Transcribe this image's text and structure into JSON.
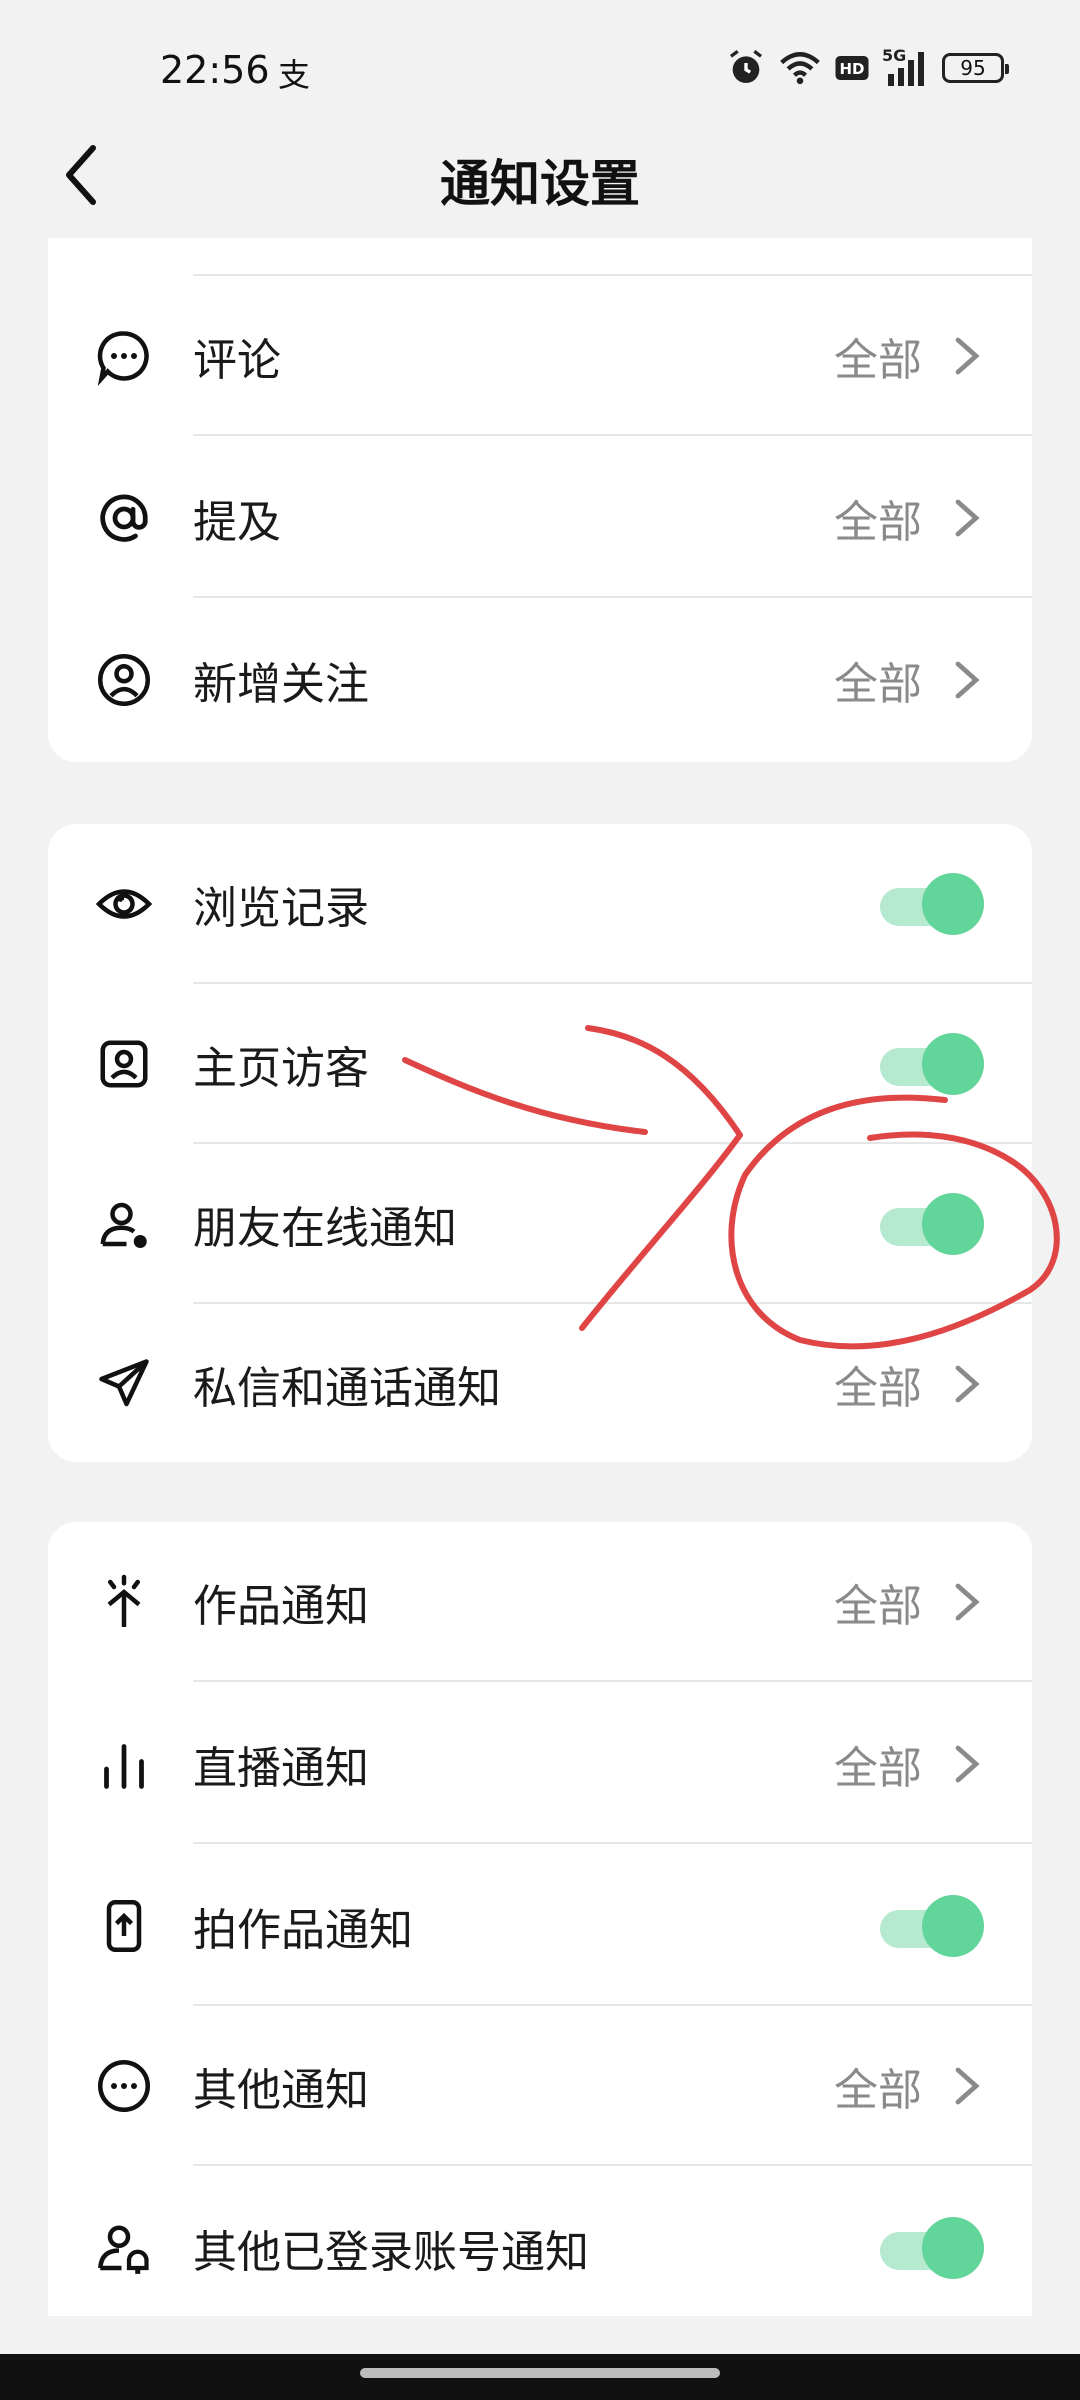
{
  "status": {
    "time": "22:56",
    "extra": "支",
    "battery": "95",
    "network": "5G"
  },
  "header": {
    "title": "通知设置"
  },
  "sections": {
    "s1": [
      {
        "label": "评论",
        "value": "全部"
      },
      {
        "label": "提及",
        "value": "全部"
      },
      {
        "label": "新增关注",
        "value": "全部"
      }
    ],
    "s2": [
      {
        "label": "浏览记录",
        "toggle": true
      },
      {
        "label": "主页访客",
        "toggle": true
      },
      {
        "label": "朋友在线通知",
        "toggle": true
      },
      {
        "label": "私信和通话通知",
        "value": "全部"
      }
    ],
    "s3": [
      {
        "label": "作品通知",
        "value": "全部"
      },
      {
        "label": "直播通知",
        "value": "全部"
      },
      {
        "label": "拍作品通知",
        "toggle": true
      },
      {
        "label": "其他通知",
        "value": "全部"
      },
      {
        "label": "其他已登录账号通知",
        "toggle": true
      }
    ]
  },
  "colors": {
    "toggle_on": "#62d59a",
    "toggle_track": "#b5ead0",
    "annotation": "#e04545"
  }
}
